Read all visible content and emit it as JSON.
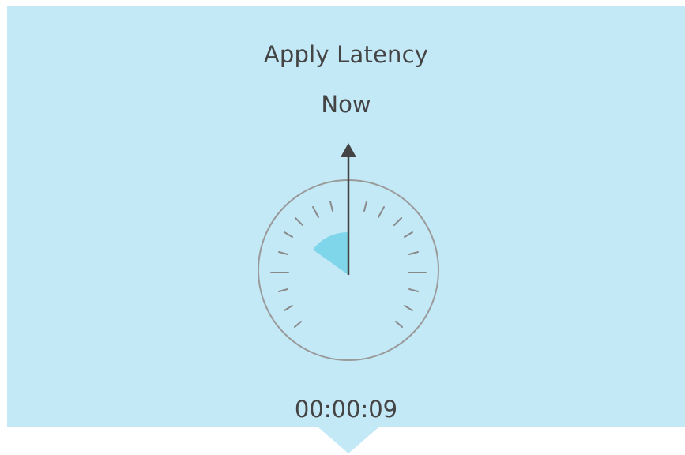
{
  "panel": {
    "title": "Apply Latency",
    "subtitle": "Now",
    "timer": "00:00:09"
  },
  "gauge": {
    "icon": "latency-gauge-icon",
    "highlight_color": "#7fd6ea",
    "needle_color": "#444444"
  },
  "colors": {
    "tile_background": "#c3e8f6",
    "text": "#444444"
  }
}
